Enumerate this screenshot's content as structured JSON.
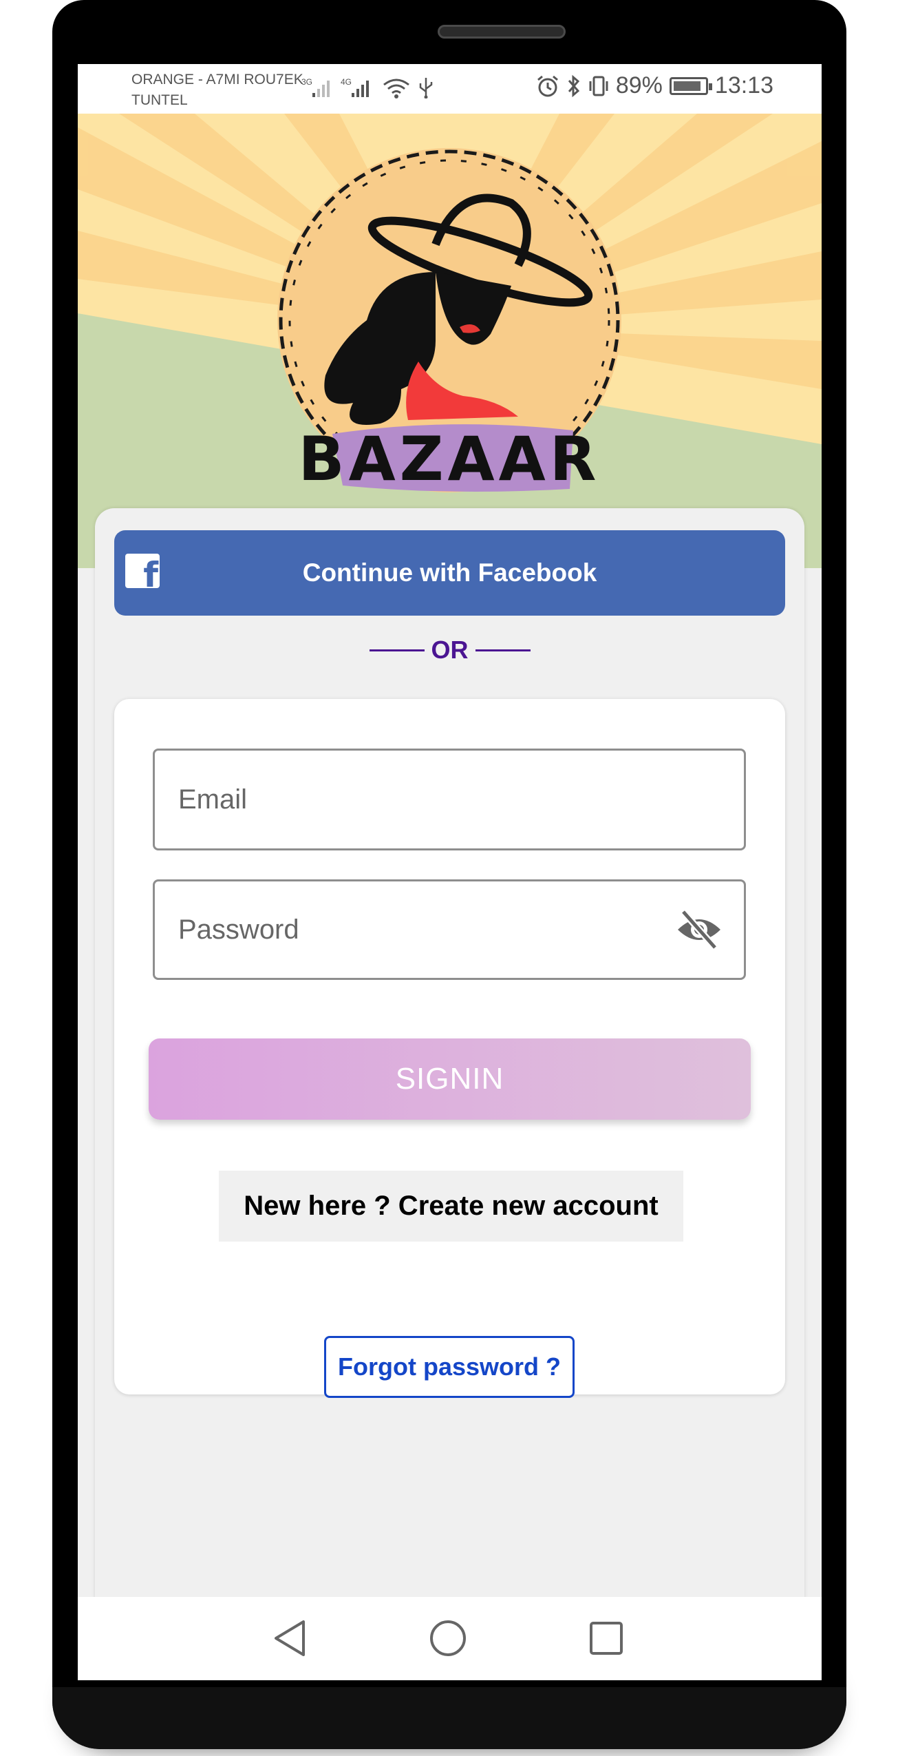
{
  "status_bar": {
    "carrier_line1": "ORANGE - A7MI ROU7EK",
    "carrier_line2": "TUNTEL",
    "network_1": "3G",
    "network_2": "4G",
    "battery_percent": "89%",
    "time": "13:13"
  },
  "brand": {
    "logo_text": "BAZAAR"
  },
  "facebook": {
    "label": "Continue with Facebook",
    "icon": "facebook-icon",
    "color": "#4569b2"
  },
  "divider": {
    "text": "OR",
    "color": "#4b1592"
  },
  "form": {
    "email_placeholder": "Email",
    "password_placeholder": "Password",
    "password_toggle_icon": "eye-off-icon",
    "signin_label": "SIGNIN",
    "create_account_label": "New here ? Create new account",
    "forgot_password_label": "Forgot password ?",
    "forgot_password_color": "#1446c8"
  },
  "navigation": {
    "back_icon": "back-triangle-icon",
    "home_icon": "home-circle-icon",
    "recents_icon": "recents-square-icon"
  }
}
